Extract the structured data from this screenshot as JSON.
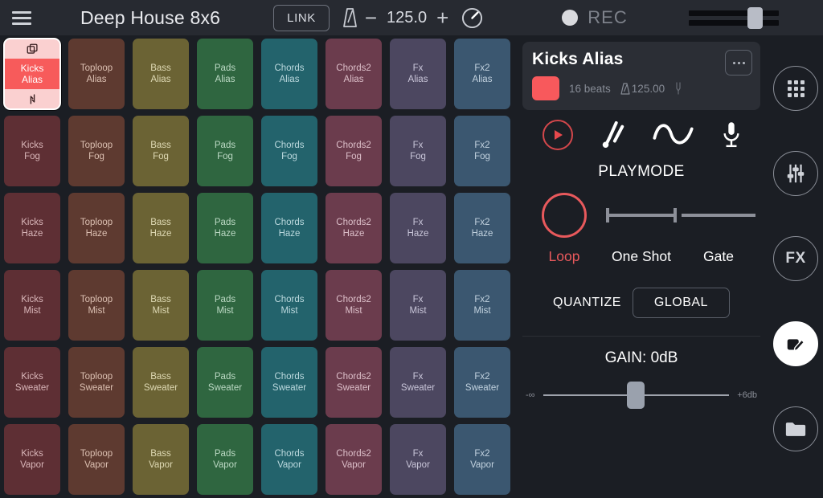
{
  "topbar": {
    "menu_icon": "hamburger-icon",
    "title": "Deep House 8x6",
    "link_label": "LINK",
    "metronome_icon": "metronome-icon",
    "minus_label": "−",
    "bpm": "125.0",
    "plus_label": "+",
    "tap_tempo_icon": "tap-tempo-dial-icon",
    "rec_label": "REC",
    "rec_icon": "record-dot-icon",
    "master_volume_icon": "master-volume-slider"
  },
  "grid": {
    "columns": [
      {
        "name": "Kicks",
        "bg": "#5e2f34",
        "fg": "#d9b6b9"
      },
      {
        "name": "Toploop",
        "bg": "#5e3a30",
        "fg": "#dcc0b2"
      },
      {
        "name": "Bass",
        "bg": "#6b6334",
        "fg": "#ded9b4"
      },
      {
        "name": "Pads",
        "bg": "#2f6640",
        "fg": "#bcd9c4"
      },
      {
        "name": "Chords",
        "bg": "#23636c",
        "fg": "#bcd9de"
      },
      {
        "name": "Chords2",
        "bg": "#6b3c4d",
        "fg": "#dcbfc9"
      },
      {
        "name": "Fx",
        "bg": "#4c4760",
        "fg": "#c9c6d9"
      },
      {
        "name": "Fx2",
        "bg": "#3b5770",
        "fg": "#c2d2df"
      }
    ],
    "rows": [
      "Alias",
      "Fog",
      "Haze",
      "Mist",
      "Sweater",
      "Vapor"
    ],
    "selected": {
      "row": 0,
      "col": 0,
      "label": "Kicks\nAlias",
      "copy_icon": "copy-icon",
      "swap_icon": "swap-arrows-icon"
    }
  },
  "panel": {
    "clip": {
      "name": "Kicks Alias",
      "more_label": "…",
      "color": "#f8595c",
      "beats": "16 beats",
      "bpm": "125.00",
      "metronome_icon": "metronome-icon",
      "tuning_fork_icon": "tuning-fork-icon"
    },
    "tools": [
      {
        "icon": "play-icon",
        "name": "play"
      },
      {
        "icon": "tuning-fork-icon",
        "name": "tune"
      },
      {
        "icon": "waveform-icon",
        "name": "waveform"
      },
      {
        "icon": "microphone-icon",
        "name": "record"
      }
    ],
    "playmode": {
      "title": "PLAYMODE",
      "options": [
        {
          "label": "Loop",
          "active": true
        },
        {
          "label": "One Shot",
          "active": false
        },
        {
          "label": "Gate",
          "active": false
        }
      ],
      "accent": "#e8595c"
    },
    "quantize": {
      "label": "QUANTIZE",
      "value": "GLOBAL"
    },
    "gain": {
      "title": "GAIN: 0dB",
      "min_label": "-∞",
      "max_label": "+6db",
      "position_pct": 45
    }
  },
  "rail": [
    {
      "name": "pads-grid",
      "icon": "grid-dots-icon",
      "active": false
    },
    {
      "name": "mixer",
      "icon": "mixer-sliders-icon",
      "active": false
    },
    {
      "name": "fx",
      "icon": "fx-text-icon",
      "label": "FX",
      "active": false
    },
    {
      "name": "edit",
      "icon": "edit-pencil-icon",
      "active": true
    },
    {
      "name": "files",
      "icon": "folder-icon",
      "active": false
    }
  ]
}
